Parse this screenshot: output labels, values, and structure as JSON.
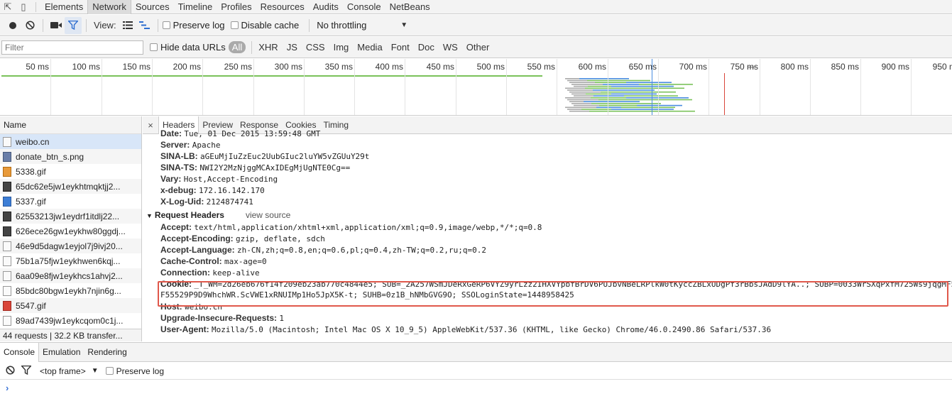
{
  "topbar": {
    "tabs": [
      "Elements",
      "Network",
      "Sources",
      "Timeline",
      "Profiles",
      "Resources",
      "Audits",
      "Console",
      "NetBeans"
    ],
    "active_tab": "Network"
  },
  "toolbar": {
    "view_label": "View:",
    "preserve_log": "Preserve log",
    "disable_cache": "Disable cache",
    "throttling": "No throttling"
  },
  "filterbar": {
    "filter_placeholder": "Filter",
    "hide_data_urls": "Hide data URLs",
    "types": [
      "All",
      "XHR",
      "JS",
      "CSS",
      "Img",
      "Media",
      "Font",
      "Doc",
      "WS",
      "Other"
    ]
  },
  "overview": {
    "ticks": [
      "50 ms",
      "100 ms",
      "150 ms",
      "200 ms",
      "250 ms",
      "300 ms",
      "350 ms",
      "400 ms",
      "450 ms",
      "500 ms",
      "550 ms",
      "600 ms",
      "650 ms",
      "700 ms",
      "750 ms",
      "800 ms",
      "850 ms",
      "900 ms",
      "950 ms"
    ]
  },
  "requests": {
    "header": "Name",
    "items": [
      {
        "name": "weibo.cn",
        "icon": "doc"
      },
      {
        "name": "donate_btn_s.png",
        "icon": "png"
      },
      {
        "name": "5338.gif",
        "icon": "gif"
      },
      {
        "name": "65dc62e5jw1eykhtmqktjj2...",
        "icon": "dark"
      },
      {
        "name": "5337.gif",
        "icon": "blue"
      },
      {
        "name": "62553213jw1eydrf1itdlj22...",
        "icon": "dark"
      },
      {
        "name": "626ece26gw1eykhw80ggdj...",
        "icon": "dark"
      },
      {
        "name": "46e9d5dagw1eyjol7j9ivj20...",
        "icon": "doc"
      },
      {
        "name": "75b1a75fjw1eykhwen6kqj...",
        "icon": "doc"
      },
      {
        "name": "6aa09e8fjw1eykhcs1ahvj2...",
        "icon": "doc"
      },
      {
        "name": "85bdc80bgw1eykh7njin6g...",
        "icon": "doc"
      },
      {
        "name": "5547.gif",
        "icon": "red"
      },
      {
        "name": "89ad7439jw1eykcqom0c1j...",
        "icon": "doc"
      }
    ],
    "status": "44 requests | 32.2 KB transfer..."
  },
  "details": {
    "tabs": [
      "Headers",
      "Preview",
      "Response",
      "Cookies",
      "Timing"
    ],
    "active_tab": "Headers",
    "response_headers": [
      {
        "k": "Date:",
        "v": "Tue, 01 Dec 2015 13:59:48 GMT"
      },
      {
        "k": "Server:",
        "v": "Apache"
      },
      {
        "k": "SINA-LB:",
        "v": "aGEuMjIuZzEuc2UubGIuc2luYW5vZGUuY29t"
      },
      {
        "k": "SINA-TS:",
        "v": "NWI2Y2MzNjggMCAxIDEgMjUgNTE0Cg=="
      },
      {
        "k": "Vary:",
        "v": "Host,Accept-Encoding"
      },
      {
        "k": "x-debug:",
        "v": "172.16.142.170"
      },
      {
        "k": "X-Log-Uid:",
        "v": "2124874741"
      }
    ],
    "request_section": "Request Headers",
    "view_source": "view source",
    "request_headers": [
      {
        "k": "Accept:",
        "v": "text/html,application/xhtml+xml,application/xml;q=0.9,image/webp,*/*;q=0.8"
      },
      {
        "k": "Accept-Encoding:",
        "v": "gzip, deflate, sdch"
      },
      {
        "k": "Accept-Language:",
        "v": "zh-CN,zh;q=0.8,en;q=0.6,pl;q=0.4,zh-TW;q=0.2,ru;q=0.2"
      },
      {
        "k": "Cache-Control:",
        "v": "max-age=0"
      },
      {
        "k": "Connection:",
        "v": "keep-alive"
      }
    ],
    "cookie": {
      "k": "Cookie:",
      "line1": "_T_WM=2d26eb676f14f209eb23ab770c4844e5; SUB=_2A257WSmJDeRxGeRP6VYZ9yrLzz2IHXVYpbfBrDV6PUJbvNBeLRPlkW0tKyccZBLxUDgPf3rBbsJAdD9lYA..; SUBP=0033WrSXqPxfM725Ws9jqgMF55529P9D9WhchWR.ScVWE1xRNUIMp1Ho5JpX5K-t",
      "line2": "F55529P9D9WhchWR.ScVWE1xRNUIMp1Ho5JpX5K-t; SUHB=0z1B_hNMbGVG9O; SSOLoginState=1448958425"
    },
    "request_headers_after": [
      {
        "k": "Host:",
        "v": "weibo.cn"
      },
      {
        "k": "Upgrade-Insecure-Requests:",
        "v": "1"
      },
      {
        "k": "User-Agent:",
        "v": "Mozilla/5.0 (Macintosh; Intel Mac OS X 10_9_5) AppleWebKit/537.36 (KHTML, like Gecko) Chrome/46.0.2490.86 Safari/537.36"
      }
    ]
  },
  "drawer": {
    "tabs": [
      "Console",
      "Emulation",
      "Rendering"
    ],
    "active_tab": "Console",
    "frame": "<top frame>",
    "preserve_log": "Preserve log",
    "prompt": "›"
  },
  "colors": {
    "highlight_border": "#e0584b",
    "wf_blue": "#4a8de0",
    "wf_green": "#7ac25a",
    "wf_gray": "#a8a8a8"
  }
}
